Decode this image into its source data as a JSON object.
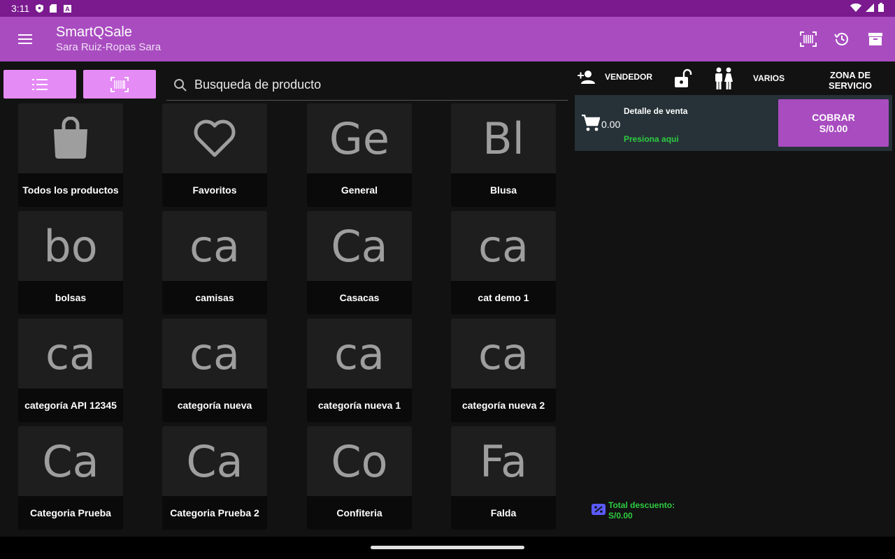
{
  "status": {
    "time": "3:11",
    "icons": [
      "shield-icon",
      "sd-card-icon",
      "a-letter-icon"
    ],
    "right_icons": [
      "wifi-icon",
      "signal-icon",
      "battery-icon"
    ]
  },
  "appbar": {
    "title": "SmartQSale",
    "subtitle": "Sara Ruiz-Ropas Sara",
    "actions": [
      "barcode-scan-icon",
      "history-icon",
      "archive-icon"
    ]
  },
  "search": {
    "placeholder": "Busqueda de producto"
  },
  "categories": [
    {
      "label": "Todos los productos",
      "icon": "shopping-bag-icon",
      "thumb": ""
    },
    {
      "label": "Favoritos",
      "icon": "heart-icon",
      "thumb": ""
    },
    {
      "label": "General",
      "icon": "",
      "thumb": "Ge"
    },
    {
      "label": "Blusa",
      "icon": "",
      "thumb": "Bl"
    },
    {
      "label": "bolsas",
      "icon": "",
      "thumb": "bo"
    },
    {
      "label": "camisas",
      "icon": "",
      "thumb": "ca"
    },
    {
      "label": "Casacas",
      "icon": "",
      "thumb": "Ca"
    },
    {
      "label": "cat demo 1",
      "icon": "",
      "thumb": "ca"
    },
    {
      "label": "categoría API 12345",
      "icon": "",
      "thumb": "ca"
    },
    {
      "label": "categoría nueva",
      "icon": "",
      "thumb": "ca"
    },
    {
      "label": "categoría nueva 1",
      "icon": "",
      "thumb": "ca"
    },
    {
      "label": "categoría nueva 2",
      "icon": "",
      "thumb": "ca"
    },
    {
      "label": "Categoria Prueba",
      "icon": "",
      "thumb": "Ca"
    },
    {
      "label": "Categoria Prueba 2",
      "icon": "",
      "thumb": "Ca"
    },
    {
      "label": "Confiteria",
      "icon": "",
      "thumb": "Co"
    },
    {
      "label": "Falda",
      "icon": "",
      "thumb": "Fa"
    }
  ],
  "toolbar2": {
    "vendedor": "VENDEDOR",
    "varios": "VARIOS",
    "zona": "ZONA DE SERVICIO"
  },
  "sale": {
    "detalle": "Detalle de venta",
    "amount": "0.00",
    "presiona": "Presiona aqui",
    "cobrar_label": "COBRAR",
    "cobrar_amount": "S/0.00"
  },
  "discount": {
    "label": "Total descuento:",
    "value": "S/0.00"
  },
  "colors": {
    "appbar": "#a94cc0",
    "statusbar": "#7a1a8e",
    "button": "#e58bf5",
    "accent_green": "#2ecc40",
    "discount_icon": "#5b5bff"
  }
}
